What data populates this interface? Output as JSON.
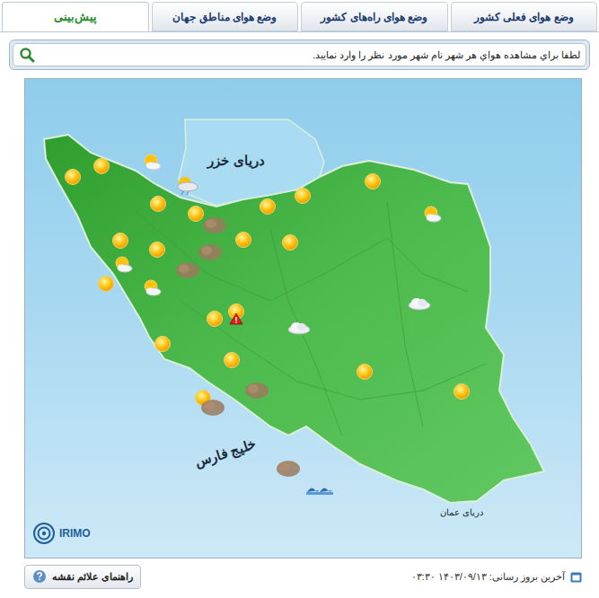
{
  "tabs": [
    {
      "label": "پیش‌بینی",
      "selected": true
    },
    {
      "label": "وضع هوای مناطق جهان",
      "selected": false
    },
    {
      "label": "وضع هوای راه‌های کشور",
      "selected": false
    },
    {
      "label": "وضع هوای فعلی کشور",
      "selected": false
    }
  ],
  "search": {
    "placeholder": "لطفا براي مشاهده هواي هر شهر نام شهر مورد نظر را وارد نماييد."
  },
  "map": {
    "labels": [
      "دریای خزر",
      "خلیج فارس",
      "دریای عمان"
    ],
    "logo": "IRIMO",
    "markers": [
      {
        "kind": "sun"
      },
      {
        "kind": "sun"
      },
      {
        "kind": "partly-cloudy"
      },
      {
        "kind": "rain-cloud"
      },
      {
        "kind": "sun"
      },
      {
        "kind": "sun"
      },
      {
        "kind": "dust"
      },
      {
        "kind": "sun"
      },
      {
        "kind": "sun"
      },
      {
        "kind": "sun"
      },
      {
        "kind": "partly-cloudy"
      },
      {
        "kind": "sun"
      },
      {
        "kind": "sun"
      },
      {
        "kind": "dust"
      },
      {
        "kind": "sun"
      },
      {
        "kind": "sun"
      },
      {
        "kind": "partly-cloudy"
      },
      {
        "kind": "dust"
      },
      {
        "kind": "sun"
      },
      {
        "kind": "partly-cloudy"
      },
      {
        "kind": "sun"
      },
      {
        "kind": "warning"
      },
      {
        "kind": "sun"
      },
      {
        "kind": "cloud"
      },
      {
        "kind": "cloud"
      },
      {
        "kind": "sun"
      },
      {
        "kind": "sun"
      },
      {
        "kind": "sun"
      },
      {
        "kind": "sun"
      },
      {
        "kind": "dust"
      },
      {
        "kind": "sun"
      },
      {
        "kind": "dust"
      },
      {
        "kind": "dust"
      },
      {
        "kind": "waves"
      }
    ]
  },
  "footer": {
    "legend_button": "راهنمای علائم نقشه",
    "updated": "آخرین بروز رسانی: ۱۴۰۳/۰۹/۱۳ ۰۳:۳۰"
  }
}
